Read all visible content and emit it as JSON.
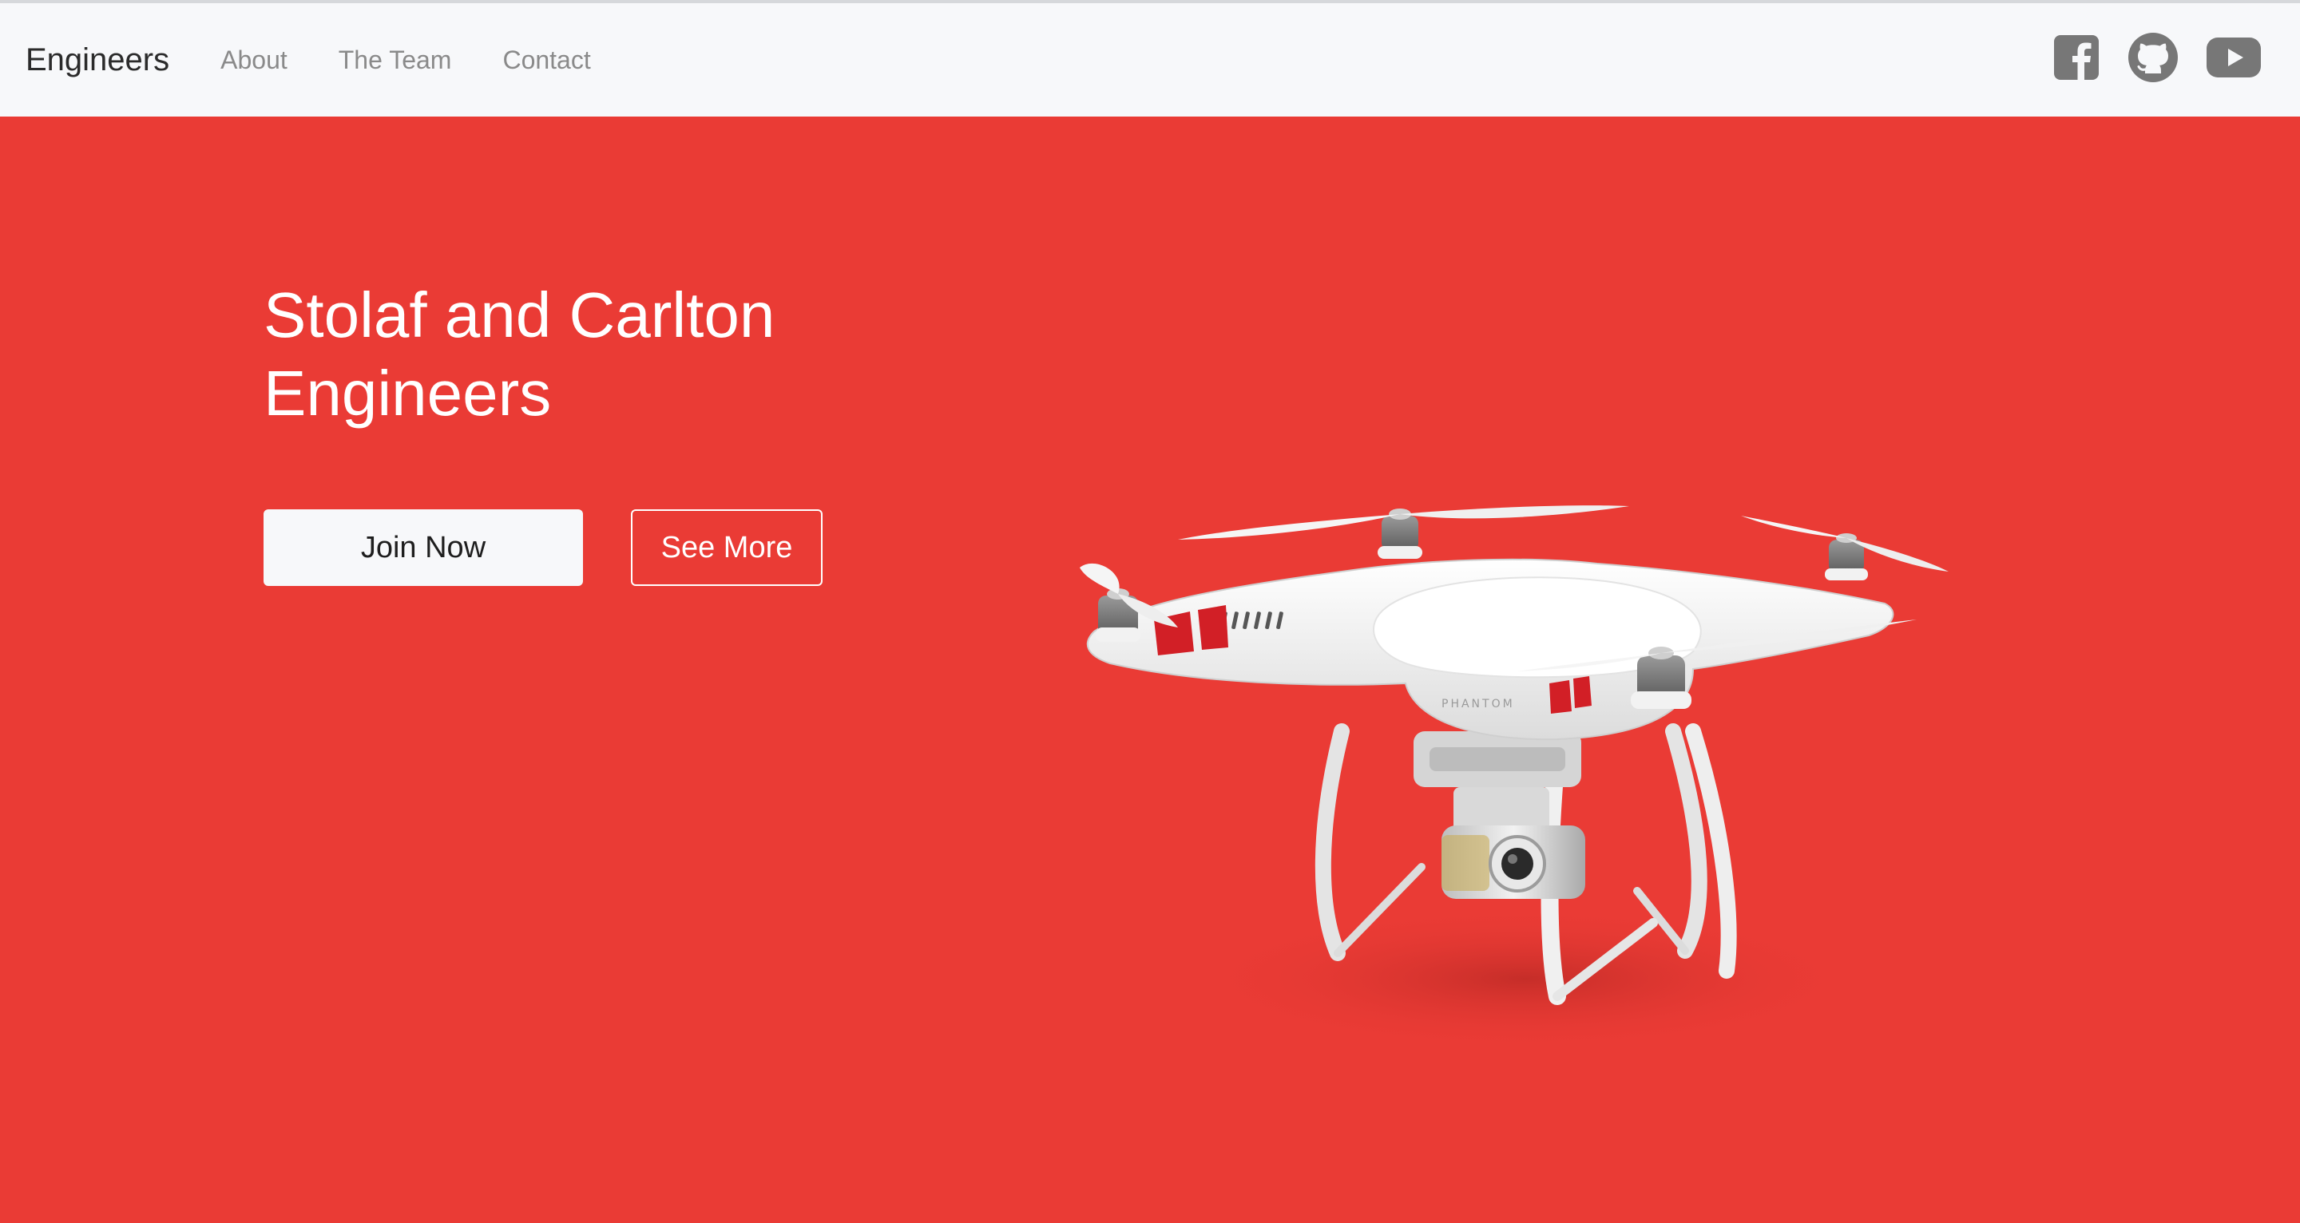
{
  "nav": {
    "brand": "Engineers",
    "links": [
      "About",
      "The Team",
      "Contact"
    ],
    "social_icons": [
      "facebook-icon",
      "github-icon",
      "youtube-icon"
    ]
  },
  "hero": {
    "title_line1": "Stolaf and Carlton",
    "title_line2": "Engineers",
    "primary_button": "Join Now",
    "secondary_button": "See More",
    "image": "drone-image",
    "drone_label": "PHANTOM"
  },
  "colors": {
    "hero_background": "#ea3b35",
    "navbar_background": "#f7f8fa",
    "icon_gray": "#777777"
  }
}
